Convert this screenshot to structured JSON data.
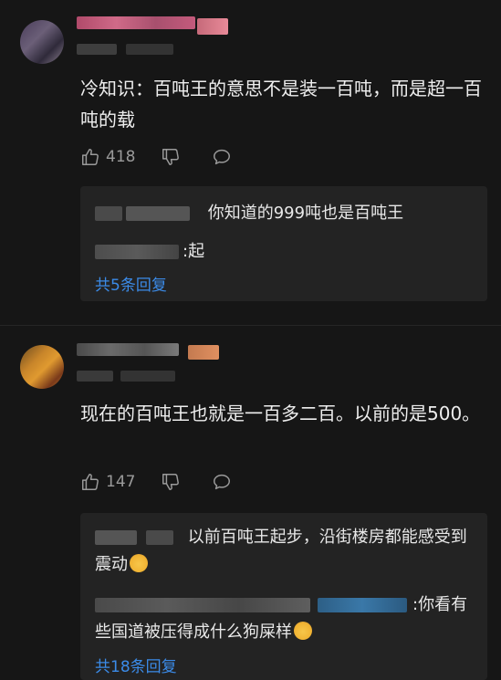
{
  "comments": [
    {
      "text": "冷知识：百吨王的意思不是装一百吨，而是超一百吨的载",
      "likes": "418",
      "replies": [
        {
          "text": "你知道的999吨也是百吨王"
        },
        {
          "text": ":起"
        }
      ],
      "more_label": "共5条回复"
    },
    {
      "text": "现在的百吨王也就是一百多二百。以前的是500。",
      "likes": "147",
      "replies": [
        {
          "text": "以前百吨王起步，沿街楼房都能感受到震动"
        },
        {
          "text": ":你看有些国道被压得成什么狗屎样"
        }
      ],
      "more_label": "共18条回复"
    }
  ],
  "icons": {
    "like": "thumbs-up-icon",
    "dislike": "thumbs-down-icon",
    "reply": "speech-bubble-icon",
    "emoji_1": "cat-face-emoji",
    "emoji_2": "angry-face-emoji"
  },
  "colors": {
    "background": "#161616",
    "reply_box": "#232323",
    "link": "#3b8be8",
    "muted": "#9a9a9a"
  }
}
